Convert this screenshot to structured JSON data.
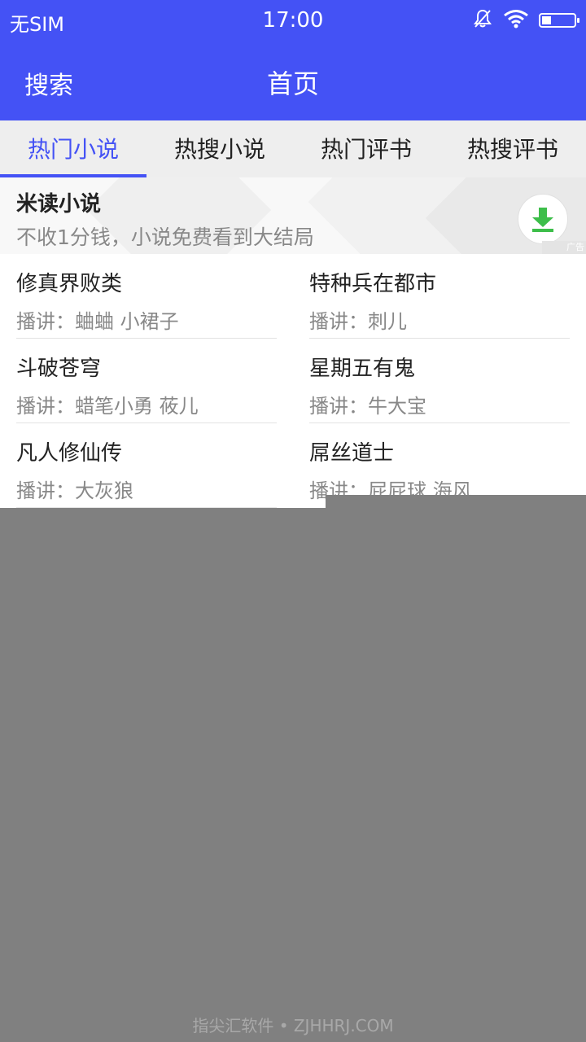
{
  "status_bar": {
    "carrier": "无SIM",
    "time": "17:00",
    "icons": [
      "mute-icon",
      "wifi-icon",
      "battery-icon"
    ],
    "battery_level": 0.3
  },
  "app_bar": {
    "search_label": "搜索",
    "title": "首页"
  },
  "tabs": [
    {
      "label": "热门小说",
      "active": true
    },
    {
      "label": "热搜小说",
      "active": false
    },
    {
      "label": "热门评书",
      "active": false
    },
    {
      "label": "热搜评书",
      "active": false
    }
  ],
  "ad": {
    "title": "米读小说",
    "subtitle": "不收1分钱，小说免费看到大结局",
    "badge": "广告",
    "icon": "download-icon"
  },
  "items": [
    {
      "name": "修真界败类",
      "narrator": "播讲：蛐蛐 小裙子"
    },
    {
      "name": "特种兵在都市",
      "narrator": "播讲：刺儿"
    },
    {
      "name": "斗破苍穹",
      "narrator": "播讲：蜡笔小勇 莜儿"
    },
    {
      "name": "星期五有鬼",
      "narrator": "播讲：牛大宝"
    },
    {
      "name": "凡人修仙传",
      "narrator": "播讲：大灰狼"
    },
    {
      "name": "屌丝道士",
      "narrator": "播讲：屁屁球 海风"
    }
  ],
  "watermark": "指尖汇软件 • ZJHHRJ.COM",
  "colors": {
    "primary": "#4452F5",
    "tab_bg": "#EEEEEE",
    "overlay": "#808080",
    "download_green": "#3DBE4A"
  }
}
